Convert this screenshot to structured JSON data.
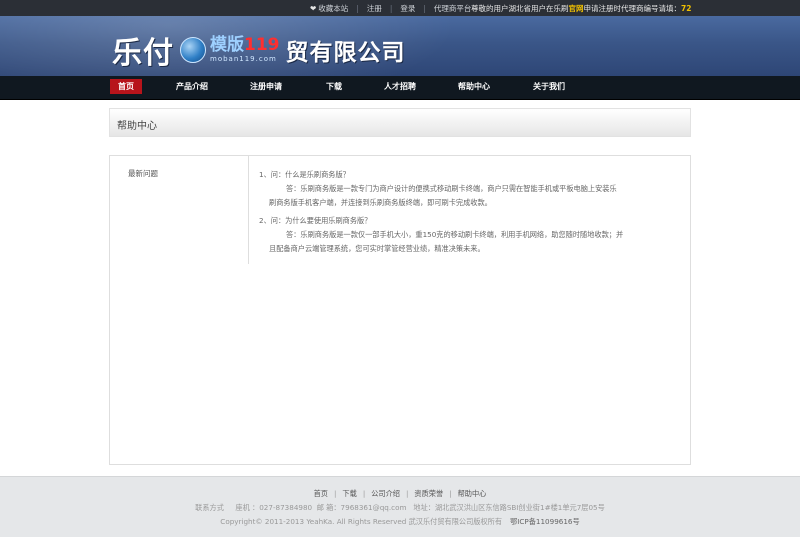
{
  "topbar": {
    "favorite_icon": "heart-icon",
    "favorite_label": "收藏本站",
    "register_label": "注册",
    "login_label": "登录",
    "agent_label": "代理商平台",
    "notice_prefix": "尊敬的用户湖北省用户在乐刷",
    "notice_highlight": "官网",
    "notice_middle": "申请注册时代理商编号请填：",
    "notice_code": "72",
    "highlight_color": "#f0c000"
  },
  "header": {
    "brand": "乐付",
    "watermark_main": "模版",
    "watermark_num": "119",
    "watermark_url": "moban119.com",
    "company": "贸有限公司"
  },
  "nav": {
    "items": [
      {
        "label": "首页"
      },
      {
        "label": "产品介绍"
      },
      {
        "label": "注册申请"
      },
      {
        "label": "下载"
      },
      {
        "label": "人才招聘"
      },
      {
        "label": "帮助中心"
      },
      {
        "label": "关于我们"
      }
    ],
    "active_color": "#b7141b"
  },
  "page": {
    "title": "帮助中心",
    "sidebar_item": "最新问题",
    "faq": [
      {
        "q": "1、问：什么是乐刷商务版？",
        "a1": "答：乐刷商务版是一款专门为商户设计的便携式移动刷卡终端，商户只需在智能手机或平板电脑上安装乐",
        "a2": "刷商务版手机客户端，并连接到乐刷商务版终端，即可刷卡完成收款。"
      },
      {
        "q": "2、问：为什么要使用乐刷商务版？",
        "a1": "答：乐刷商务版是一款仅一部手机大小，重150克的移动刷卡终端，利用手机网络，助您随时随地收款；并",
        "a2": "且配备商户云端管理系统，您可实时掌管经营业绩，精准决策未来。"
      }
    ]
  },
  "footer": {
    "links": [
      "首页",
      "下载",
      "公司介绍",
      "资质荣誉",
      "帮助中心"
    ],
    "contact_label": "联系方式",
    "phone": "座机 ：027-87384980",
    "email": "邮 箱：7968361@qq.com",
    "address": "地址：湖北武汉洪山区东信路SBI创业街1#楼1单元7层05号",
    "copyright": "Copyright© 2011-2013 YeahKa. All Rights Reserved 武汉乐付贸有限公司版权所有",
    "icp": "鄂ICP备11099616号"
  }
}
